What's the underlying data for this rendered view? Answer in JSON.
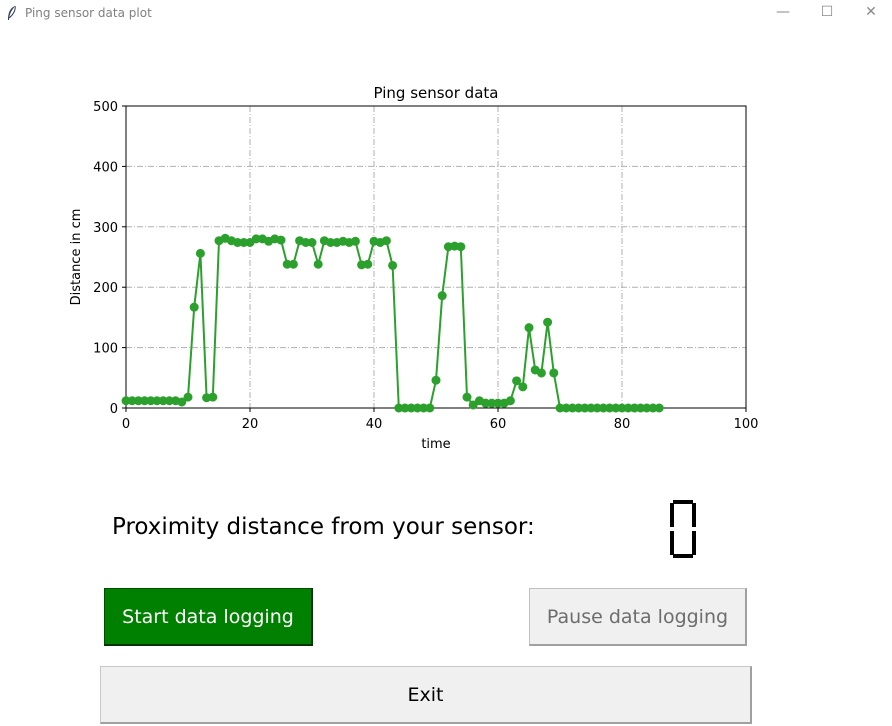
{
  "window": {
    "title": "Ping sensor data plot",
    "minimize_glyph": "—",
    "maximize_glyph": "☐",
    "close_glyph": "✕",
    "icon": "feather-icon"
  },
  "proximity": {
    "label": "Proximity distance from your sensor:",
    "value": "0"
  },
  "buttons": {
    "start_label": "Start data logging",
    "pause_label": "Pause data logging",
    "exit_label": "Exit"
  },
  "colors": {
    "series": "#2ca02c",
    "start_button": "#008000",
    "grid": "#b0b0b0"
  },
  "chart_data": {
    "type": "line",
    "title": "Ping sensor data",
    "xlabel": "time",
    "ylabel": "Distance in cm",
    "xlim": [
      0,
      100
    ],
    "ylim": [
      0,
      500
    ],
    "xticks": [
      "0",
      "20",
      "40",
      "60",
      "80",
      "100"
    ],
    "yticks": [
      "0",
      "100",
      "200",
      "300",
      "400",
      "500"
    ],
    "grid": true,
    "grid_style": "dash-dot",
    "marker": "circle",
    "series": [
      {
        "x": [
          0,
          1,
          2,
          3,
          4,
          5,
          6,
          7,
          8,
          9,
          10,
          11,
          12,
          13,
          14,
          15,
          16,
          17,
          18,
          19,
          20,
          21,
          22,
          23,
          24,
          25,
          26,
          27,
          28,
          29,
          30,
          31,
          32,
          33,
          34,
          35,
          36,
          37,
          38,
          39,
          40,
          41,
          42,
          43,
          44,
          45,
          46,
          47,
          48,
          49,
          50,
          51,
          52,
          53,
          54,
          55,
          56,
          57,
          58,
          59,
          60,
          61,
          62,
          63,
          64,
          65,
          66,
          67,
          68,
          69,
          70,
          71,
          72,
          73,
          74,
          75,
          76,
          77,
          78,
          79,
          80,
          81,
          82,
          83,
          84,
          85,
          86
        ],
        "y": [
          12,
          12,
          12,
          12,
          12,
          12,
          12,
          12,
          12,
          10,
          18,
          167,
          256,
          17,
          18,
          277,
          281,
          277,
          274,
          274,
          274,
          280,
          280,
          276,
          280,
          278,
          238,
          238,
          277,
          274,
          274,
          238,
          277,
          274,
          274,
          276,
          274,
          276,
          237,
          238,
          276,
          274,
          277,
          236,
          0,
          0,
          0,
          0,
          0,
          0,
          46,
          186,
          267,
          268,
          267,
          18,
          5,
          12,
          8,
          8,
          8,
          8,
          12,
          45,
          35,
          133,
          63,
          58,
          142,
          58,
          0,
          0,
          0,
          0,
          0,
          0,
          0,
          0,
          0,
          0,
          0,
          0,
          0,
          0,
          0,
          0,
          0
        ]
      }
    ]
  }
}
